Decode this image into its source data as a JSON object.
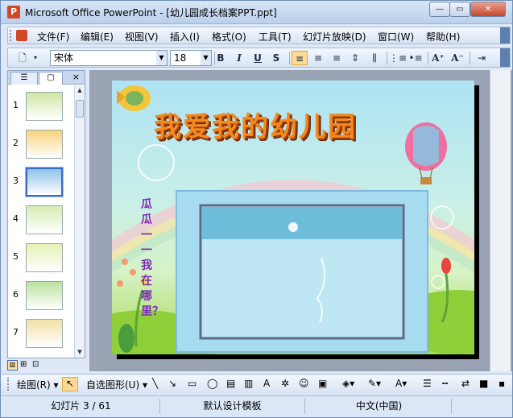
{
  "window": {
    "title": "Microsoft Office PowerPoint - [幼儿园成长档案PPT.ppt]",
    "app_icon": "powerpoint-icon"
  },
  "menu": [
    "文件(F)",
    "编辑(E)",
    "视图(V)",
    "插入(I)",
    "格式(O)",
    "工具(T)",
    "幻灯片放映(D)",
    "窗口(W)",
    "帮助(H)"
  ],
  "format": {
    "font": "宋体",
    "size": "18"
  },
  "toolbar_icons": [
    "new-icon",
    "bold-icon",
    "italic-icon",
    "underline-icon",
    "shadow-icon",
    "align-left-icon",
    "center-icon",
    "align-right-icon",
    "distribute-icon",
    "numbering-icon",
    "bullets-icon",
    "increase-font-icon",
    "decrease-font-icon",
    "indent-icon"
  ],
  "toolbar_glyphs": {
    "bold": "B",
    "italic": "I",
    "underline": "U",
    "shadow": "S",
    "grow": "A⁺",
    "shrink": "A⁻"
  },
  "slides_panel": {
    "tab_outline": "outline-icon",
    "tab_slides": "slides-icon",
    "close": "×",
    "numbers": [
      "1",
      "2",
      "3",
      "4",
      "5",
      "6",
      "7"
    ],
    "selected": 2
  },
  "slide": {
    "title": "我爱我的幼儿园",
    "side_text": "瓜瓜一一我在哪里？"
  },
  "drawing": {
    "draw_label": "绘图(R) ▾",
    "autoshape_label": "自选图形(U) ▾"
  },
  "status": {
    "slide": "幻灯片 3 / 61",
    "template": "默认设计模板",
    "language": "中文(中国)"
  }
}
